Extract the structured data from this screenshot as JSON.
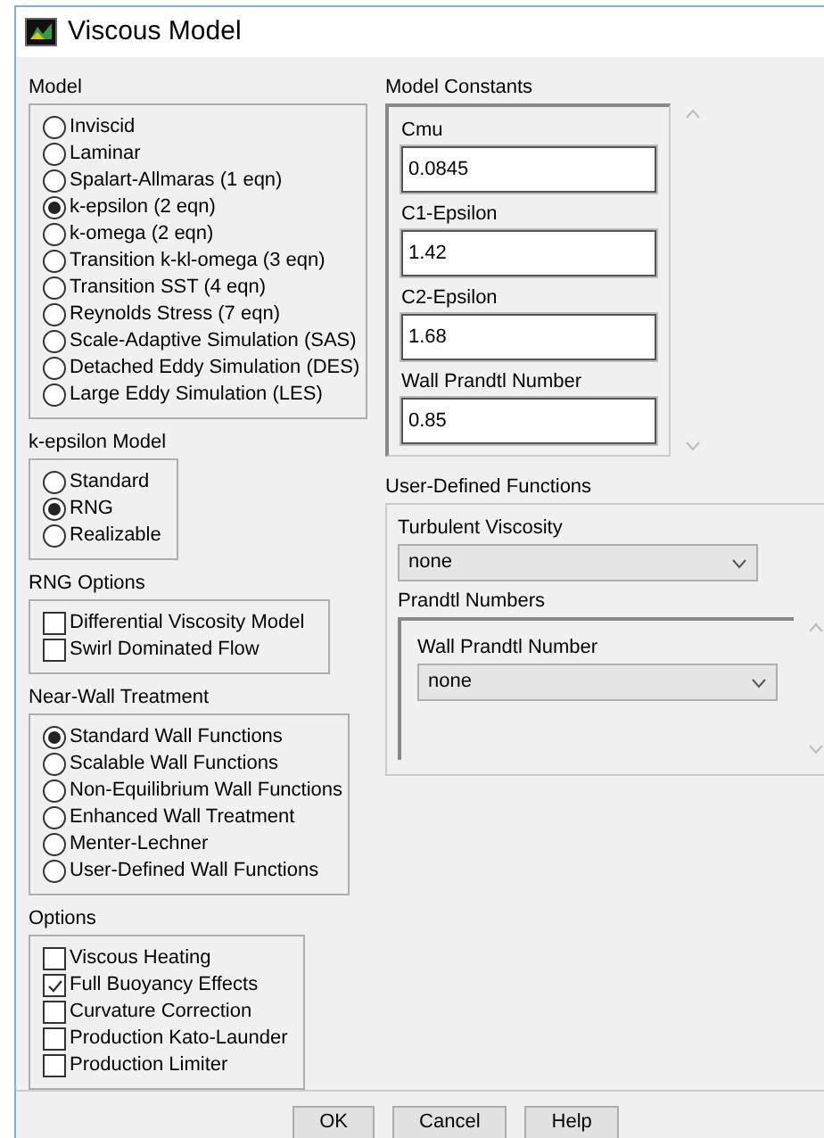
{
  "window": {
    "title": "Viscous Model"
  },
  "model": {
    "label": "Model",
    "options": [
      {
        "label": "Inviscid",
        "selected": false
      },
      {
        "label": "Laminar",
        "selected": false
      },
      {
        "label": "Spalart-Allmaras (1 eqn)",
        "selected": false
      },
      {
        "label": "k-epsilon (2 eqn)",
        "selected": true
      },
      {
        "label": "k-omega (2 eqn)",
        "selected": false
      },
      {
        "label": "Transition k-kl-omega (3 eqn)",
        "selected": false
      },
      {
        "label": "Transition SST (4 eqn)",
        "selected": false
      },
      {
        "label": "Reynolds Stress (7 eqn)",
        "selected": false
      },
      {
        "label": "Scale-Adaptive Simulation (SAS)",
        "selected": false
      },
      {
        "label": "Detached Eddy Simulation (DES)",
        "selected": false
      },
      {
        "label": "Large Eddy Simulation (LES)",
        "selected": false
      }
    ]
  },
  "k_epsilon_model": {
    "label": "k-epsilon Model",
    "options": [
      {
        "label": "Standard",
        "selected": false
      },
      {
        "label": "RNG",
        "selected": true
      },
      {
        "label": "Realizable",
        "selected": false
      }
    ]
  },
  "rng_options": {
    "label": "RNG Options",
    "options": [
      {
        "label": "Differential Viscosity Model",
        "checked": false
      },
      {
        "label": "Swirl Dominated Flow",
        "checked": false
      }
    ]
  },
  "near_wall_treatment": {
    "label": "Near-Wall Treatment",
    "options": [
      {
        "label": "Standard Wall Functions",
        "selected": true
      },
      {
        "label": "Scalable Wall Functions",
        "selected": false
      },
      {
        "label": "Non-Equilibrium Wall Functions",
        "selected": false
      },
      {
        "label": "Enhanced Wall Treatment",
        "selected": false
      },
      {
        "label": "Menter-Lechner",
        "selected": false
      },
      {
        "label": "User-Defined Wall Functions",
        "selected": false
      }
    ]
  },
  "options": {
    "label": "Options",
    "options": [
      {
        "label": "Viscous Heating",
        "checked": false
      },
      {
        "label": "Full Buoyancy Effects",
        "checked": true
      },
      {
        "label": "Curvature Correction",
        "checked": false
      },
      {
        "label": "Production Kato-Launder",
        "checked": false
      },
      {
        "label": "Production Limiter",
        "checked": false
      }
    ]
  },
  "model_constants": {
    "label": "Model Constants",
    "fields": [
      {
        "label": "Cmu",
        "value": "0.0845"
      },
      {
        "label": "C1-Epsilon",
        "value": "1.42"
      },
      {
        "label": "C2-Epsilon",
        "value": "1.68"
      },
      {
        "label": "Wall Prandtl Number",
        "value": "0.85"
      }
    ]
  },
  "user_defined_functions": {
    "label": "User-Defined Functions",
    "turbulent_viscosity": {
      "label": "Turbulent Viscosity",
      "value": "none"
    },
    "prandtl_numbers": {
      "label": "Prandtl Numbers",
      "fields": [
        {
          "label": "Wall Prandtl Number",
          "value": "none"
        }
      ]
    }
  },
  "buttons": [
    "OK",
    "Cancel",
    "Help"
  ]
}
